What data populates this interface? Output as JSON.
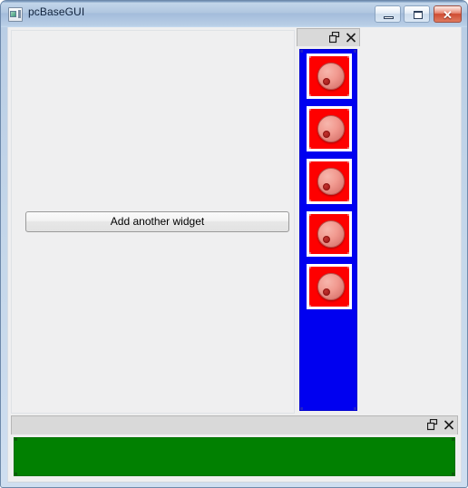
{
  "window": {
    "title": "pcBaseGUI",
    "icon": "application-icon",
    "controls": {
      "minimize": {
        "name": "minimize-button",
        "glyph": "minimize-icon",
        "label": ""
      },
      "maximize": {
        "name": "maximize-button",
        "glyph": "maximize-icon",
        "label": ""
      },
      "close": {
        "name": "close-button",
        "glyph": "close-icon",
        "label": "✕"
      }
    },
    "frame_color": "#b9cde4",
    "titlebar_text_color": "#10223c"
  },
  "central": {
    "background_color": "#efeff0",
    "button": {
      "label": "Add another widget",
      "name": "add-another-widget-button"
    }
  },
  "dock_right": {
    "title": "",
    "float_button_label": "",
    "close_button_label": "✕",
    "panel_color": "#0000f0",
    "widget_count": 5,
    "widgets": [
      {
        "index": 1,
        "frame_color": "#fe0000",
        "border_color": "#ffffff",
        "ball_color": "#f19a90",
        "dot_color": "#a81f1d"
      },
      {
        "index": 2,
        "frame_color": "#fe0000",
        "border_color": "#ffffff",
        "ball_color": "#f19a90",
        "dot_color": "#a81f1d"
      },
      {
        "index": 3,
        "frame_color": "#fe0000",
        "border_color": "#ffffff",
        "ball_color": "#f19a90",
        "dot_color": "#a81f1d"
      },
      {
        "index": 4,
        "frame_color": "#fe0000",
        "border_color": "#ffffff",
        "ball_color": "#f19a90",
        "dot_color": "#a81f1d"
      },
      {
        "index": 5,
        "frame_color": "#fe0000",
        "border_color": "#ffffff",
        "ball_color": "#f19a90",
        "dot_color": "#a81f1d"
      }
    ]
  },
  "dock_bottom": {
    "title": "",
    "float_button_label": "",
    "close_button_label": "✕",
    "panel_color": "#018001"
  }
}
